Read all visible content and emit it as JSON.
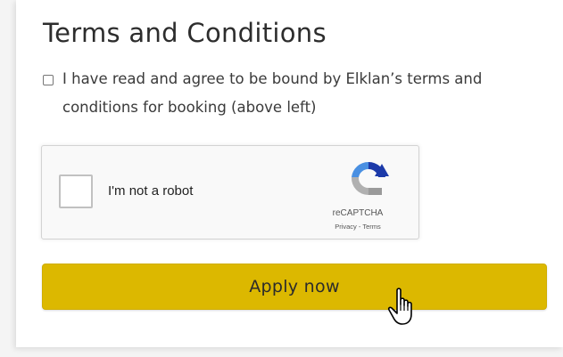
{
  "terms": {
    "heading": "Terms and Conditions",
    "agree_label": "I have read and agree to be bound by Elklan’s terms and conditions for booking (above left)",
    "agree_checked": false
  },
  "recaptcha": {
    "label": "I'm not a robot",
    "brand": "reCAPTCHA",
    "privacy_link": "Privacy",
    "separator": " - ",
    "terms_link": "Terms",
    "checked": false,
    "icon": "recaptcha-logo-icon"
  },
  "actions": {
    "apply_label": "Apply now"
  },
  "cursor": {
    "icon": "hand-pointer-icon"
  },
  "colors": {
    "button_bg": "#dcb800",
    "heading_text": "#2d2d2d",
    "recaptcha_blue": "#1c3aa9",
    "recaptcha_light_blue": "#4a90e2",
    "recaptcha_gray": "#b0b0b0"
  }
}
